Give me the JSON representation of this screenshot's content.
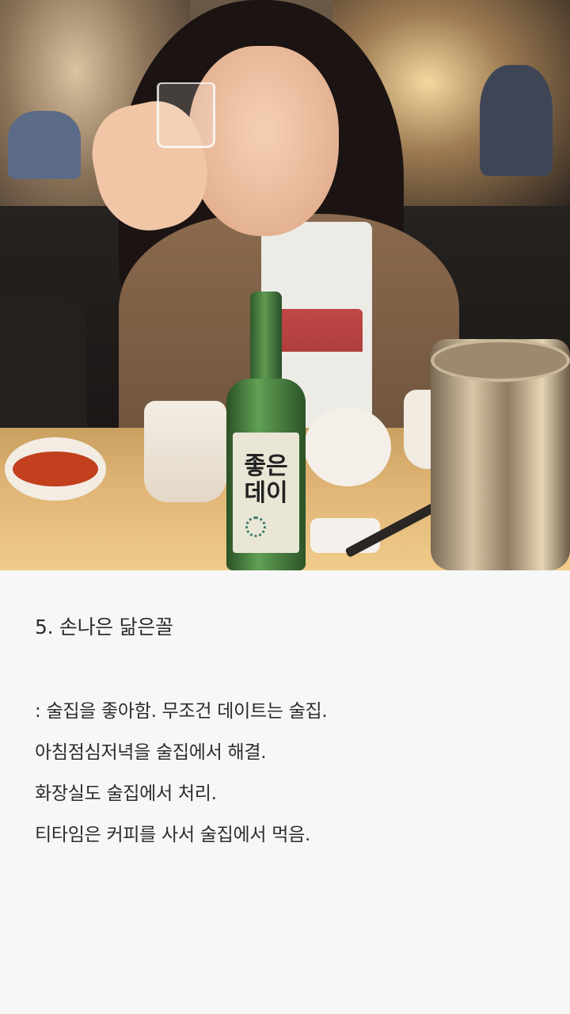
{
  "photo": {
    "description_icon": "photo-image",
    "bottle_label": "좋은데이"
  },
  "post": {
    "title": "5. 손나은 닮은꼴",
    "lines": [
      ": 술집을 좋아함. 무조건 데이트는 술집.",
      "아침점심저녁을 술집에서 해결.",
      "화장실도 술집에서 처리.",
      "티타임은 커피를 사서 술집에서 먹음."
    ]
  }
}
